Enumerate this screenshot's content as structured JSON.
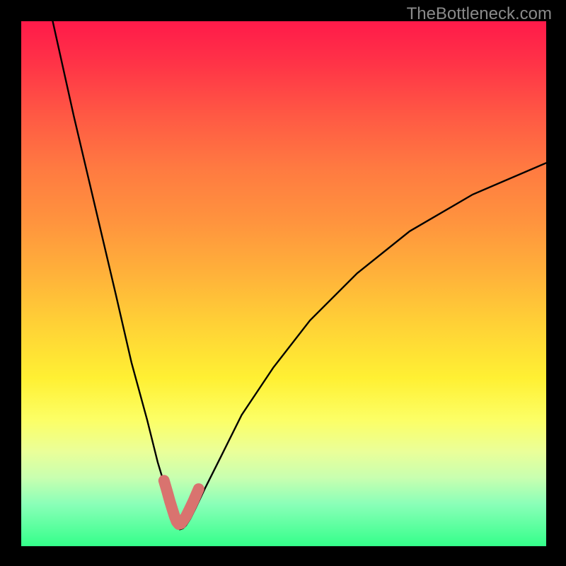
{
  "watermark": "TheBottleneck.com",
  "chart_data": {
    "type": "line",
    "title": "",
    "xlabel": "",
    "ylabel": "",
    "xlim": [
      0,
      100
    ],
    "ylim": [
      0,
      100
    ],
    "grid": false,
    "legend": false,
    "series": [
      {
        "name": "bottleneck-curve",
        "color": "#000000",
        "x": [
          6,
          10,
          14,
          18,
          21,
          24,
          26,
          27.5,
          28.5,
          29.2,
          29.7,
          30.2,
          30.8,
          31.4,
          32.2,
          33.2,
          35,
          38,
          42,
          48,
          55,
          64,
          74,
          86,
          100
        ],
        "y": [
          100,
          82,
          65,
          48,
          35,
          24,
          16,
          11,
          7.5,
          5.2,
          3.6,
          3.2,
          3.4,
          4,
          5.2,
          7.2,
          11,
          17,
          25,
          34,
          43,
          52,
          60,
          67,
          73
        ]
      },
      {
        "name": "near-bottleneck-marker",
        "color": "#d9736f",
        "x": [
          27.2,
          27.8,
          28.3,
          28.8,
          29.2,
          29.6,
          30.0,
          30.4,
          30.8,
          31.4,
          32.0,
          32.8,
          33.8
        ],
        "y": [
          12.5,
          10.4,
          8.6,
          7.0,
          5.7,
          4.7,
          4.2,
          4.3,
          4.8,
          5.7,
          6.9,
          8.6,
          10.9
        ]
      }
    ],
    "gradient_stops": [
      {
        "pos": 0.0,
        "color": "#ff1a4a"
      },
      {
        "pos": 0.18,
        "color": "#ff5944"
      },
      {
        "pos": 0.38,
        "color": "#ff933e"
      },
      {
        "pos": 0.58,
        "color": "#ffd236"
      },
      {
        "pos": 0.76,
        "color": "#fcff66"
      },
      {
        "pos": 0.92,
        "color": "#8affb8"
      },
      {
        "pos": 1.0,
        "color": "#34ff8a"
      }
    ],
    "annotations": []
  }
}
